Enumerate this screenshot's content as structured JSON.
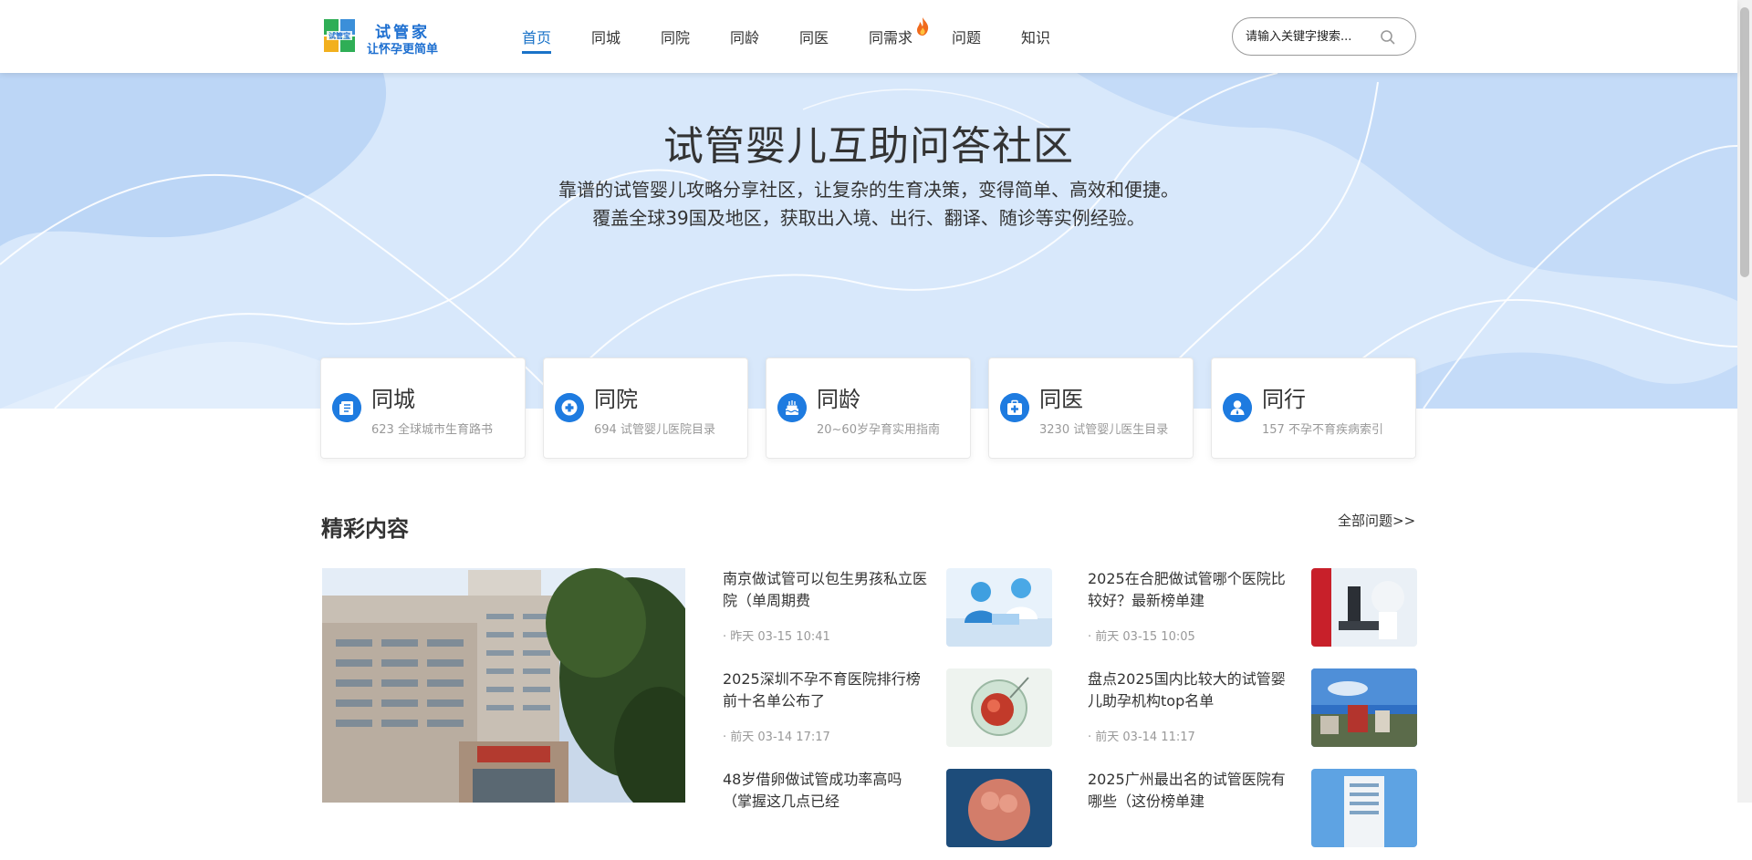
{
  "header": {
    "logo_mark": "试管宝",
    "logo_name": "试管家",
    "logo_slogan": "让怀孕更简单",
    "nav": [
      {
        "label": "首页"
      },
      {
        "label": "同城"
      },
      {
        "label": "同院"
      },
      {
        "label": "同龄"
      },
      {
        "label": "同医"
      },
      {
        "label": "同需求"
      },
      {
        "label": "问题"
      },
      {
        "label": "知识"
      }
    ],
    "active_nav": "首页",
    "hot_nav": "同需求",
    "search_placeholder": "请输入关键字搜索..."
  },
  "hero": {
    "title": "试管婴儿互助问答社区",
    "line1": "靠谱的试管婴儿攻略分享社区，让复杂的生育决策，变得简单、高效和便捷。",
    "line2": "覆盖全球39国及地区，获取出入境、出行、翻译、随诊等实例经验。"
  },
  "cards": [
    {
      "title": "同城",
      "count": "623",
      "desc": "全球城市生育路书",
      "icon": "city-doc-icon"
    },
    {
      "title": "同院",
      "count": "694",
      "desc": "试管婴儿医院目录",
      "icon": "hospital-cross-icon"
    },
    {
      "title": "同龄",
      "count": "20~60岁",
      "desc": "孕育实用指南",
      "icon": "birthday-cake-icon"
    },
    {
      "title": "同医",
      "count": "3230",
      "desc": "试管婴儿医生目录",
      "icon": "medical-kit-icon"
    },
    {
      "title": "同行",
      "count": "157",
      "desc": "不孕不育疾病索引",
      "icon": "people-icon"
    }
  ],
  "featured": {
    "section_title": "精彩内容",
    "all_link": "全部问题>>",
    "articles": [
      {
        "title": "南京做试管可以包生男孩私立医院（单周期费",
        "meta": "· 昨天 03-15 10:41"
      },
      {
        "title": "2025在合肥做试管哪个医院比较好？最新榜单建",
        "meta": "· 前天 03-15 10:05"
      },
      {
        "title": "2025深圳不孕不育医院排行榜前十名单公布了",
        "meta": "· 前天 03-14 17:17"
      },
      {
        "title": "盘点2025国内比较大的试管婴儿助孕机构top名单",
        "meta": "· 前天 03-14 11:17"
      },
      {
        "title": "48岁借卵做试管成功率高吗（掌握这几点已经",
        "meta": ""
      },
      {
        "title": "2025广州最出名的试管医院有哪些（这份榜单建",
        "meta": ""
      }
    ]
  },
  "colors": {
    "accent": "#1a73c8",
    "hero_bg": "#d6e7fb",
    "icon_blue": "#1e7be0"
  }
}
